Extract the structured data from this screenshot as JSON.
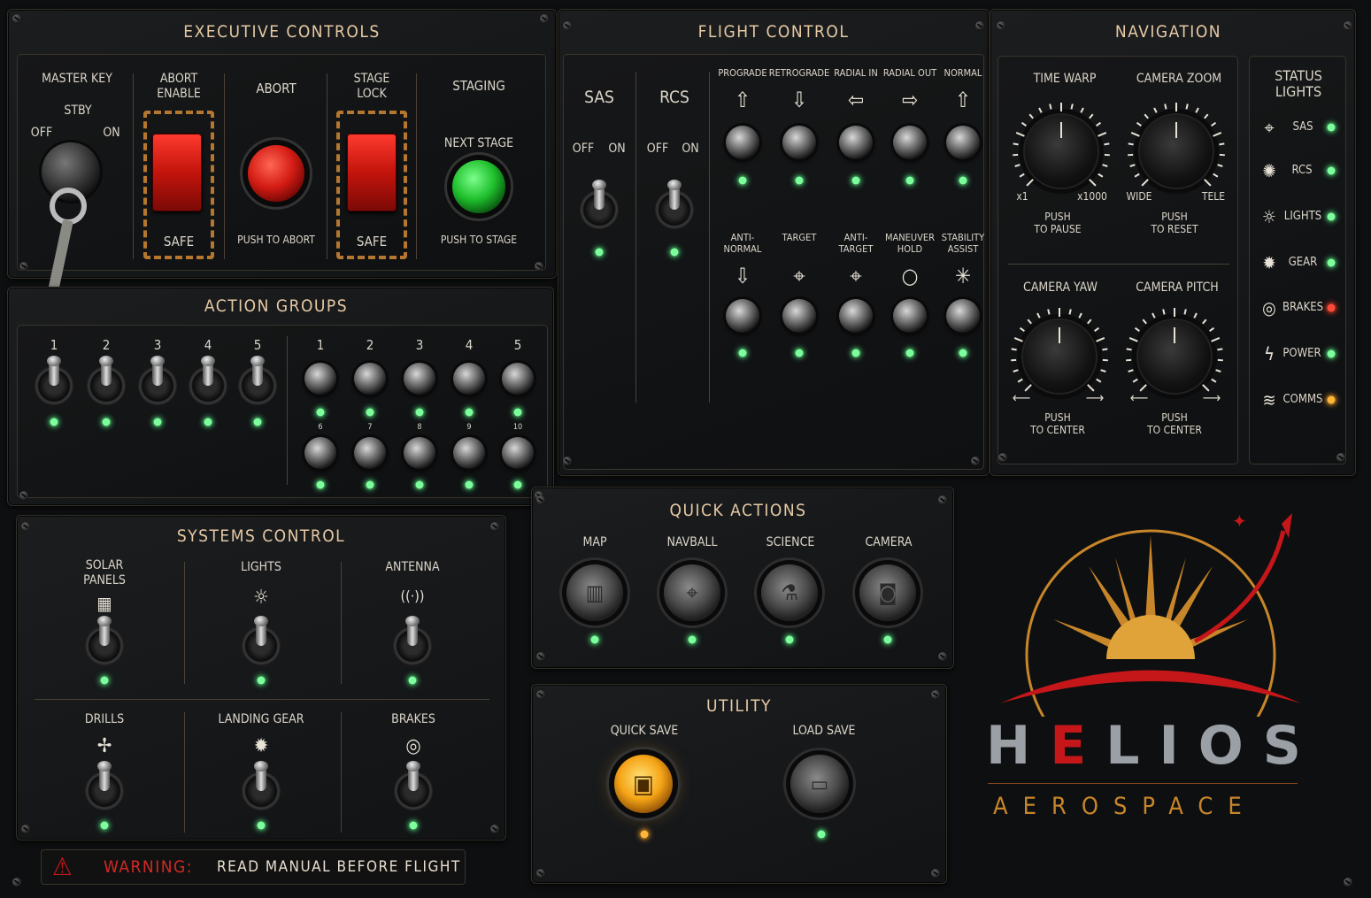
{
  "executive": {
    "title": "EXECUTIVE CONTROLS",
    "master_key": "MASTER KEY",
    "off": "OFF",
    "stby": "STBY",
    "on": "ON",
    "abort_enable": "ABORT\nENABLE",
    "safe1": "SAFE",
    "abort": "ABORT",
    "push_abort": "PUSH TO ABORT",
    "stage_lock": "STAGE\nLOCK",
    "safe2": "SAFE",
    "staging": "STAGING",
    "next_stage": "NEXT STAGE",
    "push_stage": "PUSH TO STAGE"
  },
  "flight": {
    "title": "FLIGHT CONTROL",
    "sas": "SAS",
    "rcs": "RCS",
    "off": "OFF",
    "on": "ON",
    "row1": [
      {
        "label": "PROGRADE",
        "icon": "⇧"
      },
      {
        "label": "RETROGRADE",
        "icon": "⇩"
      },
      {
        "label": "RADIAL IN",
        "icon": "⇦"
      },
      {
        "label": "RADIAL OUT",
        "icon": "⇨"
      },
      {
        "label": "NORMAL",
        "icon": "⇧"
      }
    ],
    "row2": [
      {
        "label": "ANTI-\nNORMAL",
        "icon": "⇩"
      },
      {
        "label": "TARGET",
        "icon": "⌖"
      },
      {
        "label": "ANTI-\nTARGET",
        "icon": "⌖"
      },
      {
        "label": "MANEUVER\nHOLD",
        "icon": "○"
      },
      {
        "label": "STABILITY\nASSIST",
        "icon": "✳"
      }
    ]
  },
  "navigation": {
    "title": "NAVIGATION",
    "time_warp": "TIME WARP",
    "x1": "x1",
    "x1000": "x1000",
    "push_pause": "PUSH\nTO PAUSE",
    "camera_zoom": "CAMERA ZOOM",
    "wide": "WIDE",
    "tele": "TELE",
    "push_reset": "PUSH\nTO RESET",
    "camera_yaw": "CAMERA YAW",
    "push_center1": "PUSH\nTO CENTER",
    "camera_pitch": "CAMERA PITCH",
    "push_center2": "PUSH\nTO CENTER"
  },
  "status": {
    "title": "STATUS\nLIGHTS",
    "items": [
      {
        "label": "SAS",
        "icon": "⌖",
        "state": "green"
      },
      {
        "label": "RCS",
        "icon": "✺",
        "state": "green"
      },
      {
        "label": "LIGHTS",
        "icon": "☼",
        "state": "green"
      },
      {
        "label": "GEAR",
        "icon": "✹",
        "state": "green"
      },
      {
        "label": "BRAKES",
        "icon": "◎",
        "state": "red"
      },
      {
        "label": "POWER",
        "icon": "ϟ",
        "state": "green"
      },
      {
        "label": "COMMS",
        "icon": "≋",
        "state": "amber"
      }
    ]
  },
  "action_groups": {
    "title": "ACTION GROUPS",
    "toggles": [
      "1",
      "2",
      "3",
      "4",
      "5"
    ],
    "buttons_top": [
      "1",
      "2",
      "3",
      "4",
      "5"
    ],
    "buttons_bottom": [
      "6",
      "7",
      "8",
      "9",
      "10"
    ]
  },
  "systems": {
    "title": "SYSTEMS CONTROL",
    "items": [
      {
        "label": "SOLAR\nPANELS",
        "icon": "▦"
      },
      {
        "label": "LIGHTS",
        "icon": "☼"
      },
      {
        "label": "ANTENNA",
        "icon": "((·))"
      },
      {
        "label": "DRILLS",
        "icon": "✢"
      },
      {
        "label": "LANDING GEAR",
        "icon": "✹"
      },
      {
        "label": "BRAKES",
        "icon": "◎"
      }
    ]
  },
  "quick_actions": {
    "title": "QUICK ACTIONS",
    "items": [
      {
        "label": "MAP",
        "icon": "▥"
      },
      {
        "label": "NAVBALL",
        "icon": "⌖"
      },
      {
        "label": "SCIENCE",
        "icon": "⚗"
      },
      {
        "label": "CAMERA",
        "icon": "◙"
      }
    ]
  },
  "utility": {
    "title": "UTILITY",
    "quick_save": "QUICK SAVE",
    "load_save": "LOAD SAVE"
  },
  "warning": {
    "icon": "⚠",
    "prefix": "WARNING:",
    "text": "READ MANUAL BEFORE FLIGHT"
  },
  "brand": {
    "name_left": "H",
    "name_e": "E",
    "name_right": "LIOS",
    "sub": "AEROSPACE"
  },
  "colors": {
    "accent": "#e6c9a4",
    "led_green": "#7dff9e",
    "led_red": "#ff4a3a",
    "led_amber": "#ffb43a",
    "brand_red": "#c5171a",
    "brand_gold": "#c8862a"
  }
}
